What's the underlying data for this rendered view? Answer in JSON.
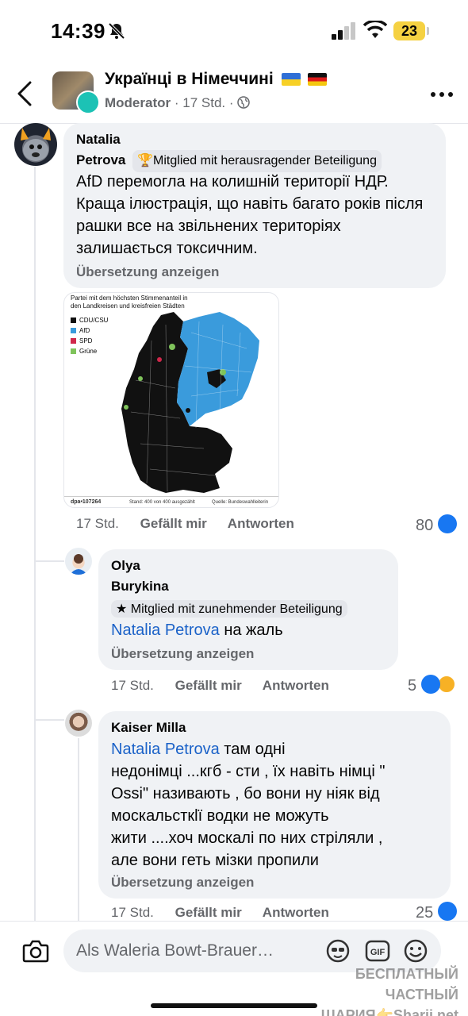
{
  "status": {
    "time": "14:39",
    "battery": "23"
  },
  "header": {
    "title": "Українці в Німеччині",
    "role": "Moderator",
    "age": "17 Std.",
    "separator": "·"
  },
  "comments": [
    {
      "first_name": "Natalia",
      "last_name": "Petrova",
      "badge": "Mitglied mit herausragender Beteiligung",
      "text": "AfD перемогла на колишній території НДР. Краща ілюстрація, що навіть багато років після рашки все на звільнених територіях залишається токсичним.",
      "translate": "Übersetzung anzeigen",
      "time": "17 Std.",
      "like": "Gefällt mir",
      "reply": "Antworten",
      "reactions": "80"
    },
    {
      "first_name": "Olya",
      "last_name": "Burykina",
      "badge": "Mitglied mit zunehmender Beteiligung",
      "mention": "Natalia Petrova",
      "text": "на жаль",
      "translate": "Übersetzung anzeigen",
      "time": "17 Std.",
      "like": "Gefällt mir",
      "reply": "Antworten",
      "reactions": "5"
    },
    {
      "name": "Kaiser Milla",
      "mention": "Natalia Petrova",
      "text_lines": [
        " там одні",
        "недонімці ...кгб - сти , їх навіть німці \"",
        "Ossi\" називають , бо вони ну ніяк від",
        "москальсткlї водки не можуть",
        "жити ....хоч москалі по них стріляли ,",
        "але вони геть мізки пропили"
      ],
      "translate": "Übersetzung anzeigen",
      "time": "17 Std.",
      "like": "Gefällt mir",
      "reply": "Antworten",
      "reactions": "25"
    }
  ],
  "map_image": {
    "title_line1": "Partei mit dem höchsten Stimmenanteil in",
    "title_line2": "den Landkreisen und kreisfreien Städten",
    "legend": [
      {
        "label": "CDU/CSU",
        "color": "#111111"
      },
      {
        "label": "AfD",
        "color": "#3a9bdc"
      },
      {
        "label": "SPD",
        "color": "#d0284b"
      },
      {
        "label": "Grüne",
        "color": "#7fc35b"
      }
    ],
    "source_id": "dpa•107264",
    "stand": "Stand: 400 von 400 ausgezählt",
    "quelle": "Quelle: Bundeswahlleiterin"
  },
  "composer": {
    "placeholder": "Als Waleria Bowt-Brauer…"
  },
  "watermark": {
    "line1": "БЕСПЛАТНЫЙ ЧАСТНЫЙ",
    "line2": "ШАРИЯ👉Sharij.net"
  },
  "colors": {
    "accent": "#1877f2",
    "mention": "#1b62c8",
    "bubble": "#f0f2f5",
    "muted": "#65676b"
  }
}
